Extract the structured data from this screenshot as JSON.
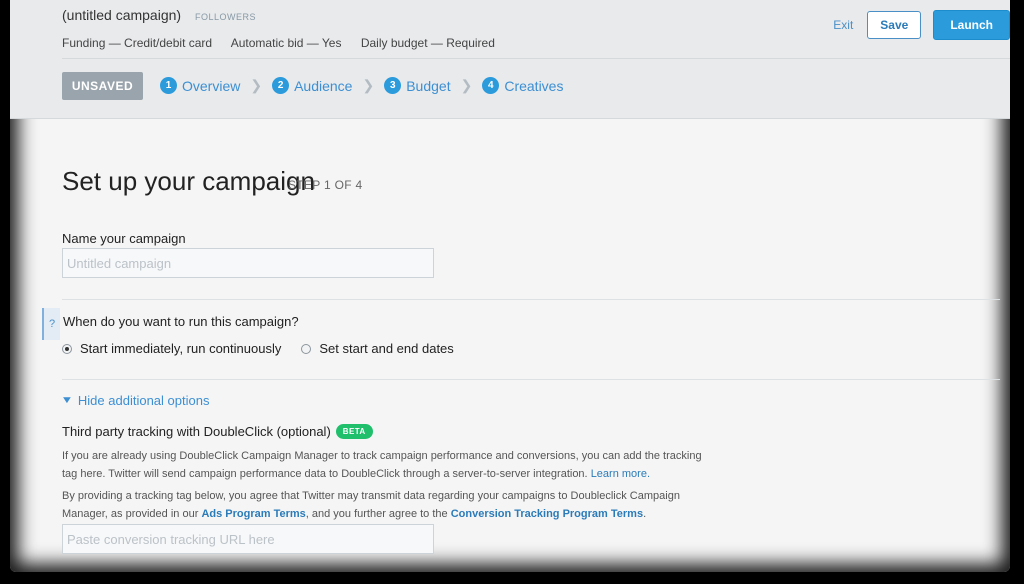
{
  "header": {
    "campaign_name": "(untitled campaign)",
    "objective": "FOLLOWERS",
    "meta": {
      "funding": "Funding — Credit/debit card",
      "bid": "Automatic bid — Yes",
      "budget": "Daily budget — Required"
    },
    "exit_label": "Exit",
    "save_label": "Save",
    "launch_label": "Launch",
    "status_badge": "UNSAVED",
    "steps": [
      {
        "num": "1",
        "label": "Overview"
      },
      {
        "num": "2",
        "label": "Audience"
      },
      {
        "num": "3",
        "label": "Budget"
      },
      {
        "num": "4",
        "label": "Creatives"
      }
    ]
  },
  "main": {
    "title": "Set up your campaign",
    "step_count": "STEP 1 OF 4",
    "name_label": "Name your campaign",
    "name_placeholder": "Untitled campaign",
    "help_glyph": "?",
    "run_question": "When do you want to run this campaign?",
    "run_options": [
      {
        "label": "Start immediately, run continuously",
        "selected": true
      },
      {
        "label": "Set start and end dates",
        "selected": false
      }
    ],
    "hide_options_label": "Hide additional options",
    "tracking_title": "Third party tracking with DoubleClick (optional)",
    "beta_label": "BETA",
    "para1_text": "If you are already using DoubleClick Campaign Manager to track campaign performance and conversions, you can add the tracking tag here. Twitter will send campaign performance data to DoubleClick through a server-to-server integration.",
    "learn_more": "Learn more.",
    "para2_text_a": "By providing a tracking tag below, you agree that Twitter may transmit data regarding your campaigns to Doubleclick Campaign Manager, as provided in our",
    "ads_terms_link": "Ads Program Terms",
    "para2_text_b": ", and you further agree to the",
    "conversion_terms_link": "Conversion Tracking Program Terms",
    "para2_text_c": ".",
    "url_placeholder": "Paste conversion tracking URL here"
  },
  "colors": {
    "accent": "#2b9bdc",
    "link": "#3c8fd3",
    "beta": "#1fbf6b",
    "unsaved_badge": "#9aa4ad"
  }
}
